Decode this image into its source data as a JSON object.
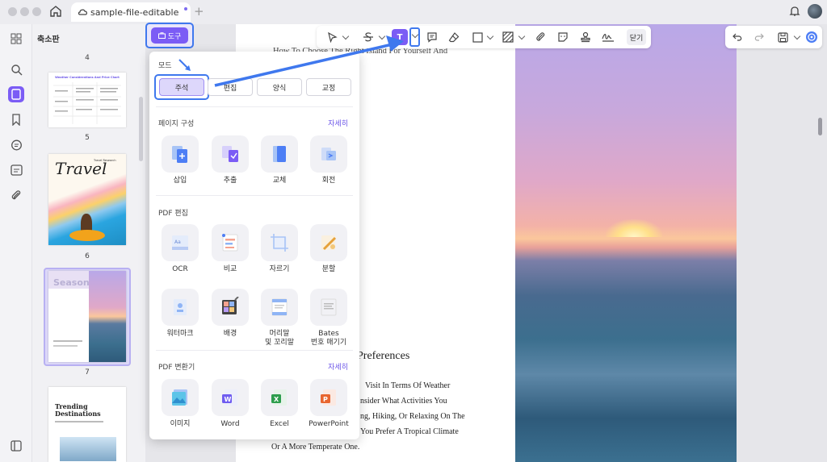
{
  "tab": {
    "title": "sample-file-editable"
  },
  "colors": {
    "accent": "#7b5cf5",
    "highlight": "#3f78ee"
  },
  "thumbnails": {
    "title": "축소판",
    "page_numbers": [
      "4",
      "5",
      "6",
      "7"
    ],
    "thumb4": {
      "title": "Weather Considerations And Price Chart"
    },
    "thumb5": {
      "title": "Travel",
      "subtitle": "Travel Research"
    },
    "thumb6": {
      "title": "Seasons"
    },
    "thumb7": {
      "title_line1": "Trending",
      "title_line2": "Destinations"
    }
  },
  "tool_button": {
    "label": "도구"
  },
  "toolbar": {
    "active_glyph": "T",
    "close_label": "닫기"
  },
  "document": {
    "line1": "How To Choose The Right Island For Yourself And",
    "heading": "Preferences",
    "para": [
      "Visit In Terms Of Weather",
      "nsider What Activities You",
      "ng, Hiking, Or Relaxing On The",
      "You Prefer A Tropical Climate",
      "Or A More Temperate One."
    ]
  },
  "panel": {
    "mode_title": "모드",
    "modes": [
      "주석",
      "편집",
      "양식",
      "교정"
    ],
    "page_section": {
      "title": "페이지 구성",
      "more": "자세히",
      "items": [
        "삽입",
        "추출",
        "교체",
        "회전"
      ]
    },
    "pdf_edit": {
      "title": "PDF 편집",
      "items": [
        "OCR",
        "비교",
        "자르기",
        "분할",
        "워터마크",
        "배경"
      ],
      "header_footer": [
        "머리말",
        "및 꼬리말"
      ],
      "bates": [
        "Bates",
        "번호 매기기"
      ]
    },
    "convert": {
      "title": "PDF 변환기",
      "more": "자세히",
      "items": [
        "이미지",
        "Word",
        "Excel",
        "PowerPoint"
      ]
    }
  }
}
